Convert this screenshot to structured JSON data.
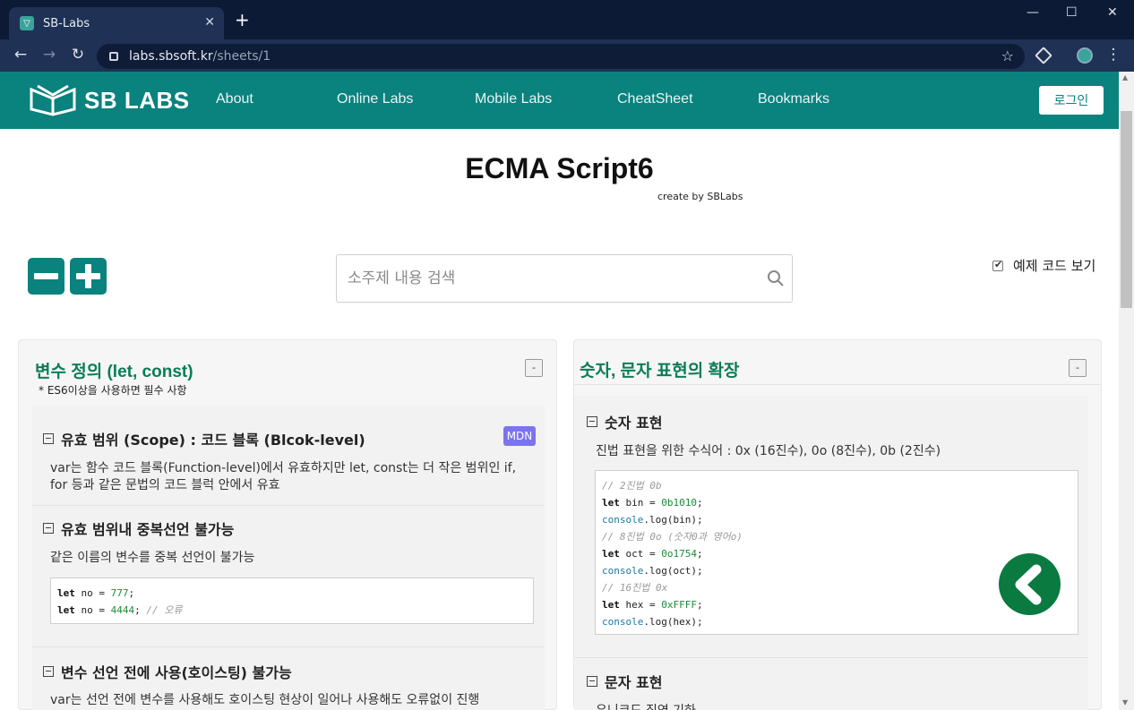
{
  "browser": {
    "tab_title": "SB-Labs",
    "new_tab": "+",
    "url_host": "labs.sbsoft.kr",
    "url_path": "/sheets/1",
    "min": "—",
    "max": "☐",
    "close": "✕",
    "tab_close": "✕",
    "back": "←",
    "forward": "→",
    "reload": "↻",
    "star": "☆",
    "menu": "⋮"
  },
  "site": {
    "logo_text": "SB LABS",
    "nav": [
      "About",
      "Online Labs",
      "Mobile Labs",
      "CheatSheet",
      "Bookmarks"
    ],
    "login": "로그인",
    "brand_color": "#0a827e"
  },
  "page": {
    "title": "ECMA Script6",
    "subtitle": "create by SBLabs",
    "search_placeholder": "소주제 내용 검색",
    "show_code_label": "예제 코드 보기",
    "show_code_checked": true
  },
  "cards": [
    {
      "title": "변수 정의 (let, const)",
      "note": "* ES6이상을 사용하면 필수 사항",
      "collapse": "-",
      "sections": [
        {
          "title": "유효 범위 (Scope) : 코드 블록 (Blcok-level)",
          "badge": "MDN",
          "text": [
            "var는 함수 코드 블록(Function-level)에서 유효하지만 let, const는 더 작은 범위인 if,",
            "for 등과 같은 문법의 코드 블럭 안에서 유효"
          ]
        },
        {
          "title": "유효 범위내 중복선언 불가능",
          "text": [
            "같은 이름의 변수를 중복 선언이 불가능"
          ],
          "code": [
            {
              "kw": "let",
              "plain": " no = ",
              "num": "777",
              "tail": ";",
              "cm": ""
            },
            {
              "kw": "let",
              "plain": " no = ",
              "num": "4444",
              "tail": "; ",
              "cm": "// 오류"
            }
          ]
        },
        {
          "title": "변수 선언 전에 사용(호이스팅) 불가능",
          "text": [
            "var는 선언 전에 변수를 사용해도 호이스팅 현상이 일어나 사용해도 오류없이 진행"
          ]
        }
      ]
    },
    {
      "title": "숫자, 문자 표현의 확장",
      "collapse": "-",
      "sections": [
        {
          "title": "숫자 표현",
          "text": [
            "진법 표현을 위한 수식어 : 0x (16진수), 0o (8진수), 0b (2진수)"
          ],
          "code": [
            {
              "cm": "// 2진법 0b"
            },
            {
              "kw": "let",
              "plain": " bin = ",
              "num": "0b1010",
              "tail": ";"
            },
            {
              "cs": "console",
              "plain": ".log(bin);"
            },
            {
              "cm": "// 8진법 0o (숫자0과 영어o)"
            },
            {
              "kw": "let",
              "plain": " oct = ",
              "num": "0o1754",
              "tail": ";"
            },
            {
              "cs": "console",
              "plain": ".log(oct);"
            },
            {
              "cm": "// 16진법 0x"
            },
            {
              "kw": "let",
              "plain": " hex = ",
              "num": "0xFFFF",
              "tail": ";"
            },
            {
              "cs": "console",
              "plain": ".log(hex);"
            }
          ]
        },
        {
          "title": "문자 표현",
          "text": [
            "유니코드 직연 기하"
          ]
        }
      ]
    }
  ]
}
